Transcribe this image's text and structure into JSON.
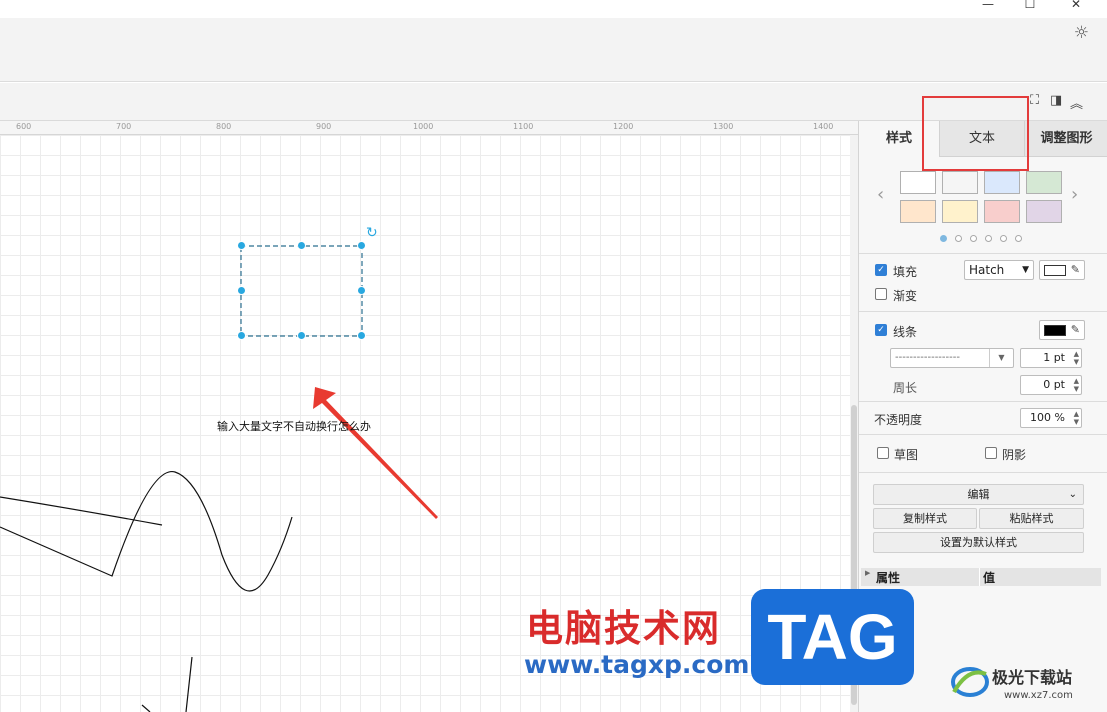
{
  "window": {
    "minimize": "—",
    "maximize": "☐",
    "close": "✕"
  },
  "ruler": {
    "ticks": [
      "600",
      "700",
      "800",
      "900",
      "1000",
      "1100",
      "1200",
      "1300",
      "1400"
    ]
  },
  "canvas": {
    "shape_text": "输入大量文字不自动换行怎么办"
  },
  "panel": {
    "tabs": {
      "style": "样式",
      "text": "文本",
      "arrange": "调整图形"
    },
    "swatches": [
      "#ffffff",
      "#f5f5f5",
      "#dae8fc",
      "#d5e8d4",
      "#ffe6cc",
      "#fff2cc",
      "#f8cecc",
      "#e1d5e7"
    ],
    "fill": {
      "label": "填充",
      "pattern": "Hatch",
      "color": "#ffffff"
    },
    "gradient": {
      "label": "渐变"
    },
    "line": {
      "label": "线条",
      "color": "#000000",
      "dash": "------------------",
      "width": "1 pt"
    },
    "perimeter": {
      "label": "周长",
      "value": "0 pt"
    },
    "opacity": {
      "label": "不透明度",
      "value": "100 %"
    },
    "sketch": {
      "label": "草图"
    },
    "shadow": {
      "label": "阴影"
    },
    "edit": {
      "label": "编辑"
    },
    "copy_style": "复制样式",
    "paste_style": "粘贴样式",
    "set_default": "设置为默认样式",
    "properties": {
      "property": "属性",
      "value": "值"
    }
  },
  "watermark": {
    "title": "电脑技术网",
    "url": "www.tagxp.com",
    "tag": "TAG",
    "logo_text": "极光下载站",
    "logo_url": "www.xz7.com"
  },
  "colors": {
    "accent": "#29a8e0",
    "highlight": "#e33b3b",
    "arrow": "#e83a30"
  }
}
